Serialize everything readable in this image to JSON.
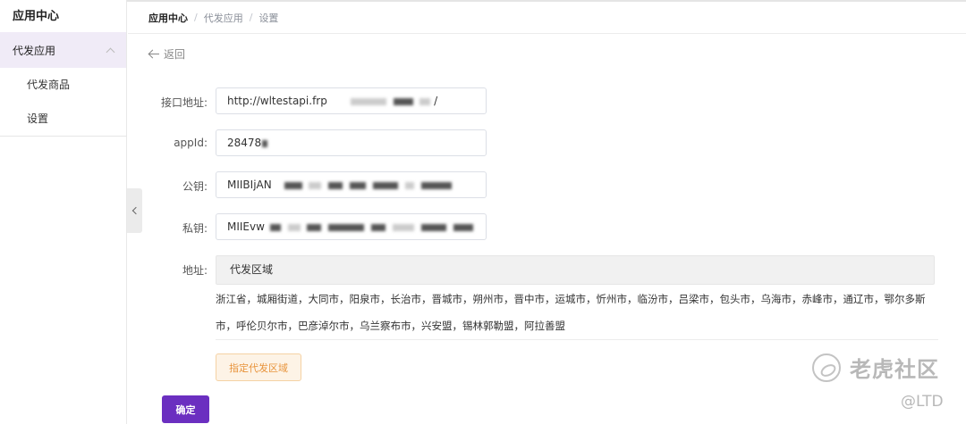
{
  "sidebar": {
    "title": "应用中心",
    "group": {
      "label": "代发应用"
    },
    "items": [
      {
        "label": "代发商品"
      },
      {
        "label": "设置"
      }
    ]
  },
  "breadcrumb": {
    "current": "应用中心",
    "sep": "/",
    "items": [
      "代发应用",
      "设置"
    ]
  },
  "back": {
    "label": "返回"
  },
  "form": {
    "api_url": {
      "label": "接口地址:",
      "value": "http://wltestapi.frp",
      "suffix": "/"
    },
    "app_id": {
      "label": "appId:",
      "value": "28478"
    },
    "public_key": {
      "label": "公钥:",
      "value": "MIIBIjAN"
    },
    "private_key": {
      "label": "私钥:",
      "value": "MIIEvw"
    },
    "address": {
      "label": "地址:",
      "region_title": "代发区域",
      "region_list": "浙江省，城厢街道，大同市，阳泉市，长治市，晋城市，朔州市，晋中市，运城市，忻州市，临汾市，吕梁市，包头市，乌海市，赤峰市，通辽市，鄂尔多斯市，呼伦贝尔市，巴彦淖尔市，乌兰察布市，兴安盟，锡林郭勒盟，阿拉善盟"
    },
    "assign_button": "指定代发区域",
    "confirm_button": "确定"
  },
  "watermark": {
    "text": "老虎社区",
    "sub": "@LTD"
  },
  "colors": {
    "primary": "#6b2fc0",
    "accent": "#e8943c",
    "sidebar_active": "#f0ebf7"
  }
}
